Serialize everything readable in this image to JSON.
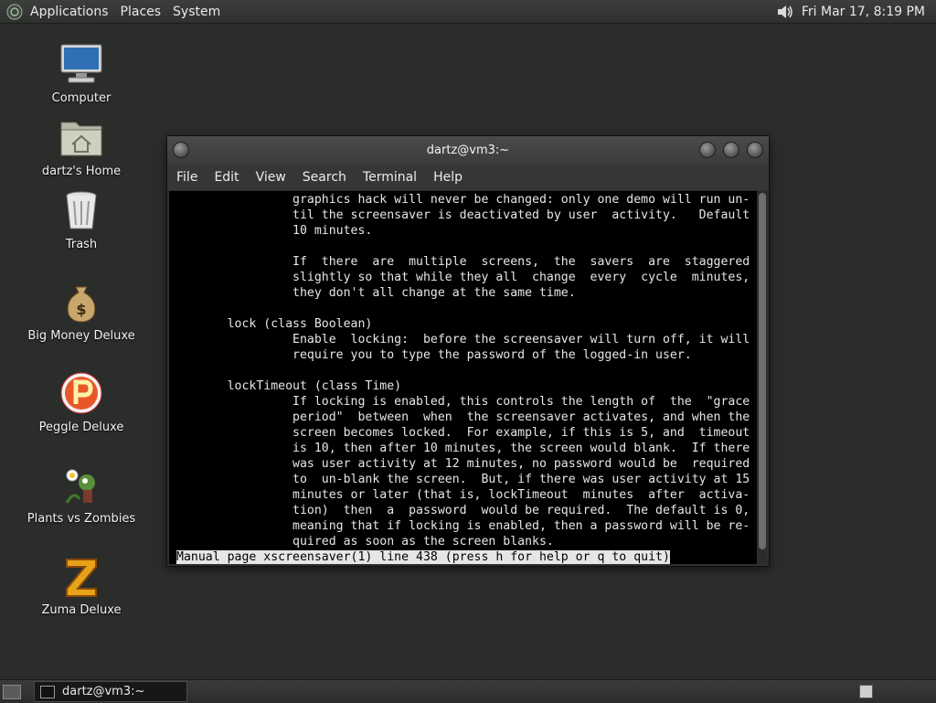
{
  "top_panel": {
    "menus": [
      "Applications",
      "Places",
      "System"
    ],
    "clock": "Fri Mar 17,  8:19 PM"
  },
  "desktop_icons": [
    {
      "label": "Computer",
      "icon": "computer-icon"
    },
    {
      "label": "dartz's Home",
      "icon": "home-folder-icon"
    },
    {
      "label": "Trash",
      "icon": "trash-icon"
    },
    {
      "label": "Big Money Deluxe",
      "icon": "money-bag-icon"
    },
    {
      "label": "Peggle Deluxe",
      "icon": "peggle-icon"
    },
    {
      "label": "Plants vs Zombies",
      "icon": "plants-zombies-icon"
    },
    {
      "label": "Zuma Deluxe",
      "icon": "zuma-icon"
    }
  ],
  "window": {
    "title": "dartz@vm3:~",
    "menus": [
      "File",
      "Edit",
      "View",
      "Search",
      "Terminal",
      "Help"
    ],
    "terminal": {
      "lines": [
        "                graphics hack will never be changed: only one demo will run un-",
        "                til the screensaver is deactivated by user  activity.   Default",
        "                10 minutes.",
        "",
        "                If  there  are  multiple  screens,  the  savers  are  staggered",
        "                slightly so that while they all  change  every  cycle  minutes,",
        "                they don't all change at the same time.",
        "",
        "       lock (class Boolean)",
        "                Enable  locking:  before the screensaver will turn off, it will",
        "                require you to type the password of the logged-in user.",
        "",
        "       lockTimeout (class Time)",
        "                If locking is enabled, this controls the length of  the  \"grace",
        "                period\"  between  when  the screensaver activates, and when the",
        "                screen becomes locked.  For example, if this is 5, and  timeout",
        "                is 10, then after 10 minutes, the screen would blank.  If there",
        "                was user activity at 12 minutes, no password would be  required",
        "                to  un-blank the screen.  But, if there was user activity at 15",
        "                minutes or later (that is, lockTimeout  minutes  after  activa-",
        "                tion)  then  a  password  would be required.  The default is 0,",
        "                meaning that if locking is enabled, then a password will be re-",
        "                quired as soon as the screen blanks."
      ],
      "status": "Manual page xscreensaver(1) line 438 (press h for help or q to quit)"
    }
  },
  "bottom_panel": {
    "task_label": "dartz@vm3:~"
  }
}
